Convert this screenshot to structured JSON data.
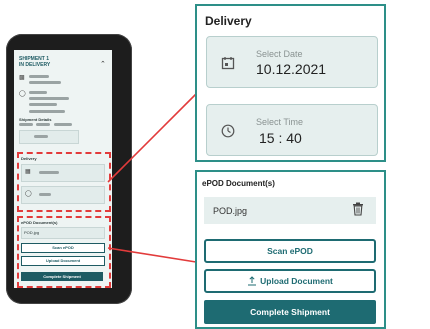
{
  "phone": {
    "title_line1": "SHIPMENT 1",
    "title_line2": "IN DELIVERY",
    "section_shipment_details": "Shipment Details",
    "section_delivery": "Delivery",
    "section_epod": "ePOD Document(s)",
    "file_name": "POD.jpg",
    "scan_label": "Scan ePOD",
    "upload_label": "Upload Document",
    "complete_label": "Complete Shipment"
  },
  "delivery": {
    "title": "Delivery",
    "date_label": "Select Date",
    "date_value": "10.12.2021",
    "time_label": "Select Time",
    "time_value": "15 : 40"
  },
  "epod": {
    "title": "ePOD Document(s)",
    "file_name": "POD.jpg",
    "scan_button": "Scan ePOD",
    "upload_button": "Upload Document",
    "complete_button": "Complete Shipment"
  },
  "colors": {
    "accent": "#1e6b72",
    "border": "#2d8f88",
    "highlight": "#e23b3b",
    "field_bg": "#e6efee"
  },
  "icons": {
    "date": "calendar-icon",
    "time": "clock-icon",
    "delete": "trash-icon",
    "upload": "upload-icon"
  }
}
